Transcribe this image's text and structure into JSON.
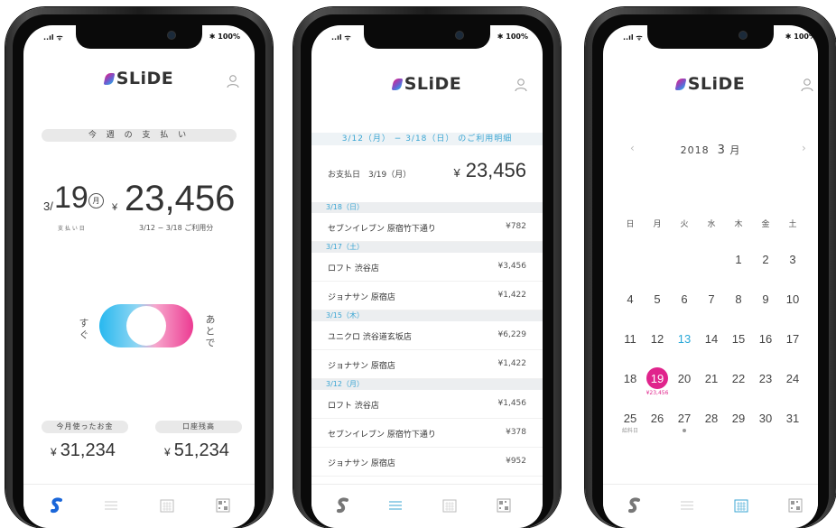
{
  "status": {
    "signal": "..ıl ᯤ",
    "battery": "✱ 100%"
  },
  "brand": {
    "logo_text": "SLiDE",
    "gradient": [
      "#e2228a",
      "#28b4e8"
    ]
  },
  "home": {
    "week_label": "今 週 の 支 払 い",
    "pay_month": "3/",
    "pay_day": "19",
    "pay_weekday": "月",
    "pay_day_label": "支 払 い 日",
    "yen": "¥",
    "amount": "23,456",
    "period": "3/12 − 3/18 ご利用分",
    "toggle_left": "すぐ",
    "toggle_right": "あとで",
    "spent_label": "今月使ったお金",
    "spent_amount": "31,234",
    "balance_label": "口座残高",
    "balance_amount": "51,234"
  },
  "statement": {
    "banner": "3/12（月） − 3/18（日） のご利用明細",
    "pay_label": "お支払日　3/19（月）",
    "yen": "¥",
    "total": "23,456",
    "sections": [
      {
        "date": "3/18（日）",
        "items": [
          {
            "name": "セブンイレブン 原宿竹下通り",
            "amount": "¥782"
          }
        ]
      },
      {
        "date": "3/17（土）",
        "items": [
          {
            "name": "ロフト 渋谷店",
            "amount": "¥3,456"
          },
          {
            "name": "ジョナサン 原宿店",
            "amount": "¥1,422"
          }
        ]
      },
      {
        "date": "3/15（木）",
        "items": [
          {
            "name": "ユニクロ 渋谷道玄坂店",
            "amount": "¥6,229"
          },
          {
            "name": "ジョナサン 原宿店",
            "amount": "¥1,422"
          }
        ]
      },
      {
        "date": "3/12（月）",
        "items": [
          {
            "name": "ロフト 渋谷店",
            "amount": "¥1,456"
          },
          {
            "name": "セブンイレブン 原宿竹下通り",
            "amount": "¥378"
          },
          {
            "name": "ジョナサン 原宿店",
            "amount": "¥952"
          }
        ]
      }
    ]
  },
  "calendar": {
    "prev": "‹",
    "next": "›",
    "year": "2018",
    "month": "3",
    "month_suffix": "月",
    "weekdays": [
      "日",
      "月",
      "火",
      "水",
      "木",
      "金",
      "土"
    ],
    "rows": [
      [
        "",
        "",
        "",
        "",
        "1",
        "2",
        "3"
      ],
      [
        "4",
        "5",
        "6",
        "7",
        "8",
        "9",
        "10"
      ],
      [
        "11",
        "12",
        "13",
        "14",
        "15",
        "16",
        "17"
      ],
      [
        "18",
        "19",
        "20",
        "21",
        "22",
        "23",
        "24"
      ],
      [
        "25",
        "26",
        "27",
        "28",
        "29",
        "30",
        "31"
      ]
    ],
    "today": "13",
    "selected": "19",
    "selected_note": "¥23,456",
    "payday_note": "給料日",
    "accent": "#e0248c",
    "today_color": "#2aa8d8"
  },
  "tabs": [
    "slide-icon",
    "list-icon",
    "calendar-icon",
    "qr-icon"
  ]
}
